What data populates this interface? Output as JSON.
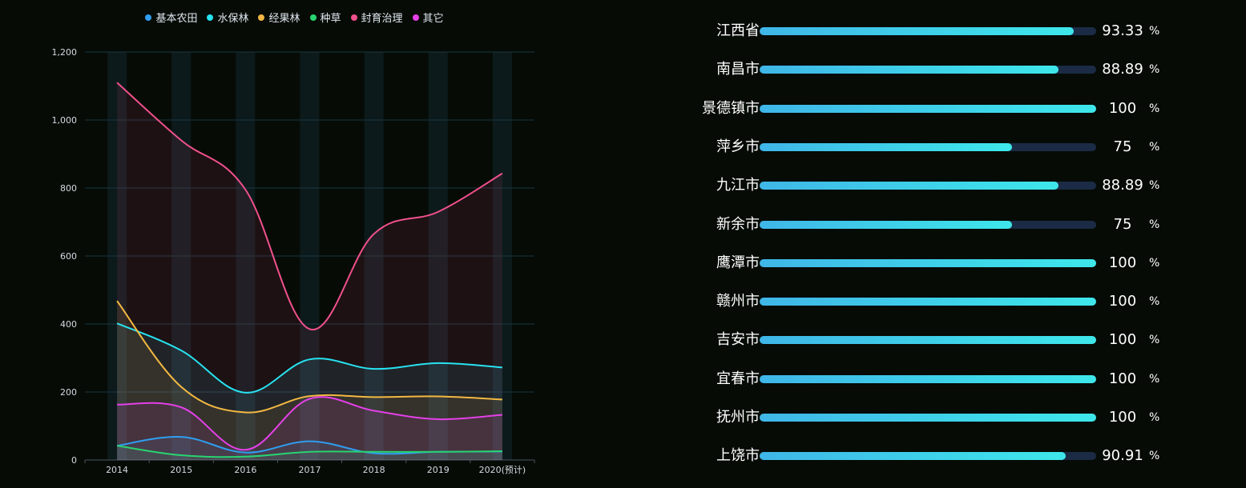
{
  "chart_data": [
    {
      "type": "area",
      "categories": [
        "2014",
        "2015",
        "2016",
        "2017",
        "2018",
        "2019",
        "2020(预计)"
      ],
      "yticks": [
        "0",
        "200",
        "400",
        "600",
        "800",
        "1,000",
        "1,200"
      ],
      "ylim": [
        0,
        1200
      ],
      "grid": true,
      "legend_position": "top-center",
      "series": [
        {
          "name": "基本农田",
          "color": "#2f9ef0",
          "values": [
            42,
            68,
            22,
            55,
            20,
            24,
            25
          ]
        },
        {
          "name": "水保林",
          "color": "#27e2f0",
          "values": [
            402,
            322,
            198,
            296,
            268,
            285,
            272
          ]
        },
        {
          "name": "经果林",
          "color": "#f3b843",
          "values": [
            468,
            215,
            140,
            188,
            185,
            187,
            178
          ]
        },
        {
          "name": "种草",
          "color": "#28d46f",
          "values": [
            42,
            14,
            10,
            24,
            24,
            24,
            26
          ]
        },
        {
          "name": "封育治理",
          "color": "#f0508c",
          "values": [
            1110,
            940,
            795,
            385,
            665,
            730,
            843
          ]
        },
        {
          "name": "其它",
          "color": "#e440e8",
          "values": [
            163,
            155,
            30,
            180,
            145,
            120,
            133
          ]
        }
      ]
    },
    {
      "type": "bar",
      "orientation": "horizontal",
      "max": 100,
      "unit": "%",
      "categories": [
        "江西省",
        "南昌市",
        "景德镇市",
        "萍乡市",
        "九江市",
        "新余市",
        "鹰潭市",
        "赣州市",
        "吉安市",
        "宜春市",
        "抚州市",
        "上饶市"
      ],
      "values": [
        93.33,
        88.89,
        100,
        75,
        88.89,
        75,
        100,
        100,
        100,
        100,
        100,
        90.91
      ],
      "labels": [
        "93.33",
        "88.89",
        "100",
        "75",
        "88.89",
        "75",
        "100",
        "100",
        "100",
        "100",
        "100",
        "90.91"
      ]
    }
  ]
}
